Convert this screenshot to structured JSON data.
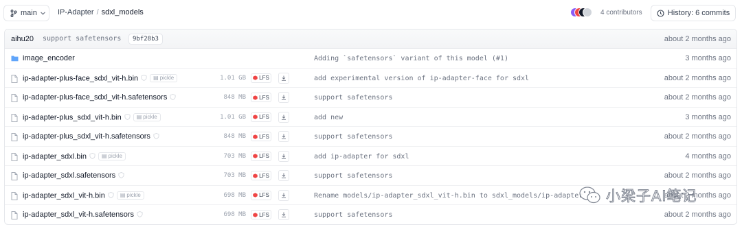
{
  "branch": {
    "label": "main"
  },
  "breadcrumb": {
    "repo": "IP-Adapter",
    "separator": "/",
    "folder": "sdxl_models"
  },
  "contributors": {
    "label": "4 contributors",
    "avatar_colors": [
      "#8b5cf6",
      "#ef4444",
      "#111827",
      "#d1d5db"
    ]
  },
  "history": {
    "label": "History: 6 commits"
  },
  "last_commit": {
    "author": "aihu20",
    "message": "support safetensors",
    "hash": "9bf28b3",
    "time": "about 2 months ago"
  },
  "files": [
    {
      "name": "image_encoder",
      "type": "folder",
      "commit": "Adding `safetensors` variant of this model (#1)",
      "time": "3 months ago"
    },
    {
      "name": "ip-adapter-plus-face_sdxl_vit-h.bin",
      "type": "file",
      "safe": true,
      "pickle": "pickle",
      "size": "1.01 GB",
      "lfs": "LFS",
      "commit": "add experimental version of ip-adapter-face for sdxl",
      "time": "about 2 months ago"
    },
    {
      "name": "ip-adapter-plus-face_sdxl_vit-h.safetensors",
      "type": "file",
      "safe": true,
      "size": "848 MB",
      "lfs": "LFS",
      "commit": "support safetensors",
      "time": "about 2 months ago"
    },
    {
      "name": "ip-adapter-plus_sdxl_vit-h.bin",
      "type": "file",
      "safe": true,
      "pickle": "pickle",
      "size": "1.01 GB",
      "lfs": "LFS",
      "commit": "add new",
      "time": "3 months ago"
    },
    {
      "name": "ip-adapter-plus_sdxl_vit-h.safetensors",
      "type": "file",
      "safe": true,
      "size": "848 MB",
      "lfs": "LFS",
      "commit": "support safetensors",
      "time": "about 2 months ago"
    },
    {
      "name": "ip-adapter_sdxl.bin",
      "type": "file",
      "safe": true,
      "pickle": "pickle",
      "size": "703 MB",
      "lfs": "LFS",
      "commit": "add ip-adapter for sdxl",
      "time": "4 months ago"
    },
    {
      "name": "ip-adapter_sdxl.safetensors",
      "type": "file",
      "safe": true,
      "size": "703 MB",
      "lfs": "LFS",
      "commit": "support safetensors",
      "time": "about 2 months ago"
    },
    {
      "name": "ip-adapter_sdxl_vit-h.bin",
      "type": "file",
      "safe": true,
      "pickle": "pickle",
      "size": "698 MB",
      "lfs": "LFS",
      "commit": "Rename models/ip-adapter_sdxl_vit-h.bin to sdxl_models/ip-adapter",
      "time": "about 2 months ago"
    },
    {
      "name": "ip-adapter_sdxl_vit-h.safetensors",
      "type": "file",
      "safe": true,
      "size": "698 MB",
      "lfs": "LFS",
      "commit": "support safetensors",
      "time": "about 2 months ago"
    }
  ],
  "watermark": {
    "text": "小梁子AI笔记"
  }
}
